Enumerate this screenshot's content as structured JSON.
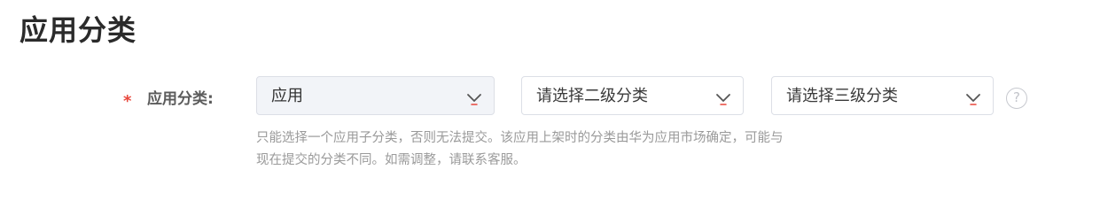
{
  "section": {
    "title": "应用分类"
  },
  "field": {
    "required_mark": "*",
    "label": "应用分类:"
  },
  "selects": {
    "level1": {
      "value": "应用"
    },
    "level2": {
      "placeholder": "请选择二级分类"
    },
    "level3": {
      "placeholder": "请选择三级分类"
    }
  },
  "help": {
    "glyph": "?"
  },
  "hint": {
    "line1": "只能选择一个应用子分类，否则无法提交。该应用上架时的分类由华为应用市场确定，可能与",
    "line2": "现在提交的分类不同。如需调整，请联系客服。"
  },
  "icons": {
    "dropdown": "chevron-down-icon",
    "help": "question-circle-icon"
  },
  "colors": {
    "required": "#e8473c",
    "selected_bg": "#f2f4f8",
    "border": "#dcdfe6",
    "chevron_underline": "#e8473c",
    "hint_text": "#9a9a9a"
  }
}
